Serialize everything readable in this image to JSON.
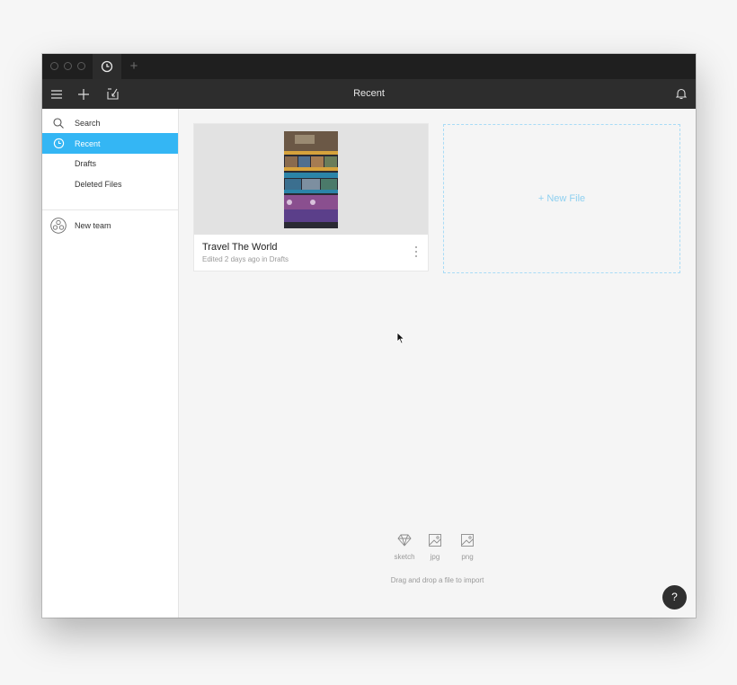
{
  "toolbar": {
    "title": "Recent"
  },
  "tabs": {
    "add_label": "+"
  },
  "sidebar": {
    "items": [
      {
        "label": "Search",
        "icon": "search-icon"
      },
      {
        "label": "Recent",
        "icon": "clock-icon",
        "active": true
      },
      {
        "label": "Drafts"
      },
      {
        "label": "Deleted Files"
      }
    ],
    "team": {
      "label": "New team",
      "icon": "team-icon"
    }
  },
  "files": [
    {
      "name": "Travel The World",
      "meta": "Edited 2 days ago in Drafts"
    }
  ],
  "new_file": {
    "label": "+ New File"
  },
  "import": {
    "types": [
      {
        "label": "sketch",
        "icon": "sketch-diamond-icon"
      },
      {
        "label": "jpg",
        "icon": "image-icon"
      },
      {
        "label": "png",
        "icon": "image-icon"
      }
    ],
    "hint": "Drag and drop a file to import"
  },
  "help": {
    "label": "?"
  },
  "colors": {
    "accent": "#34b6f4",
    "titlebar": "#1f1f1f",
    "toolbar": "#2d2d2d"
  }
}
